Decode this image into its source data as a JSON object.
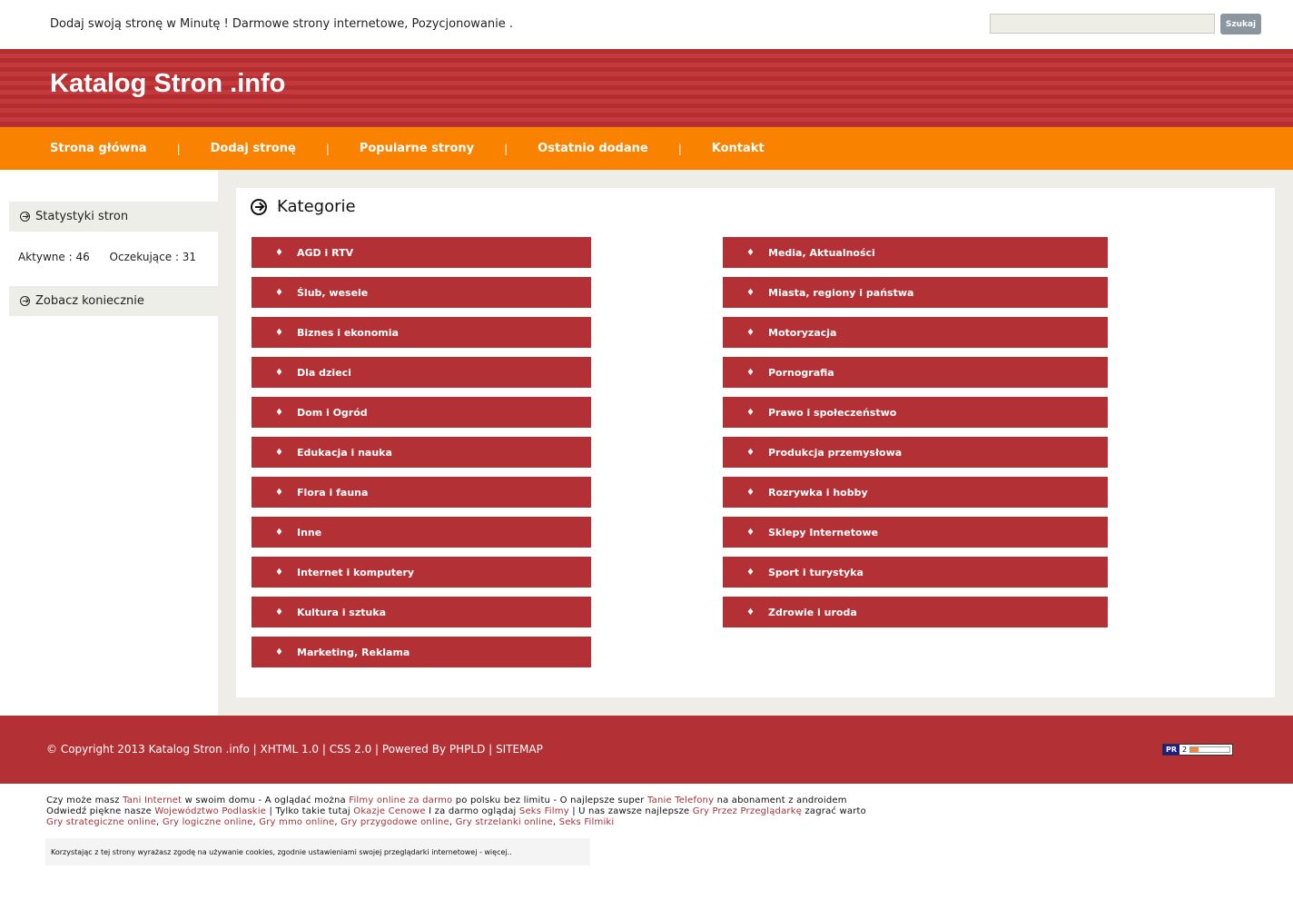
{
  "topbar": {
    "tagline": "Dodaj swoją stronę w Minutę ! Darmowe strony internetowe, Pozycjonowanie .",
    "search_button": "Szukaj"
  },
  "header": {
    "site_title": "Katalog Stron .info"
  },
  "nav": {
    "items": [
      "Strona główna",
      "Dodaj stronę",
      "Popularne strony",
      "Ostatnio dodane",
      "Kontakt"
    ],
    "separator": "|"
  },
  "sidebar": {
    "stats_title": "Statystyki stron",
    "active_label": "Aktywne : 46",
    "waiting_label": "Oczekujące : 31",
    "see_title": "Zobacz koniecznie"
  },
  "main": {
    "title": "Kategorie",
    "bullet": "♦",
    "categories_left": [
      "AGD i RTV",
      "Ślub, wesele",
      "Biznes i ekonomia",
      "Dla dzieci",
      "Dom i Ogród",
      "Edukacja i nauka",
      "Flora i fauna",
      "Inne",
      "Internet i komputery",
      "Kultura i sztuka",
      "Marketing, Reklama"
    ],
    "categories_right": [
      "Media, Aktualności",
      "Miasta, regiony i państwa",
      "Motoryzacja",
      "Pornografia",
      "Prawo i społeczeństwo",
      "Produkcja przemysłowa",
      "Rozrywka i hobby",
      "Sklepy Internetowe",
      "Sport i turystyka",
      "Zdrowie i uroda"
    ]
  },
  "footer": {
    "copyright": "© Copyright 2013 Katalog Stron .info | XHTML 1.0 | CSS 2.0 | Powered By PHPLD | SITEMAP",
    "pr_label": "PR",
    "pr_value": "2",
    "pr_fraction": 0.2
  },
  "links": {
    "line1": [
      {
        "t": "Czy może masz "
      },
      {
        "t": "Tani Internet",
        "l": true
      },
      {
        "t": " w swoim domu - A oglądać można "
      },
      {
        "t": "Filmy online za darmo",
        "l": true
      },
      {
        "t": " po polsku bez limitu - O najlepsze super "
      },
      {
        "t": "Tanie Telefony",
        "l": true
      },
      {
        "t": " na abonament z androidem"
      }
    ],
    "line2": [
      {
        "t": "Odwiedź piękne nasze "
      },
      {
        "t": "Województwo Podlaskie",
        "l": true
      },
      {
        "t": " | Tylko takie tutaj "
      },
      {
        "t": "Okazje Cenowe",
        "l": true
      },
      {
        "t": " I za darmo oglądaj "
      },
      {
        "t": "Seks Filmy",
        "l": true
      },
      {
        "t": " | U nas zawsze najlepsze "
      },
      {
        "t": "Gry Przez Przeglądarkę",
        "l": true
      },
      {
        "t": " zagrać warto"
      }
    ],
    "line3": [
      {
        "t": "Gry strategiczne online",
        "l": true
      },
      {
        "t": ", "
      },
      {
        "t": "Gry logiczne online",
        "l": true
      },
      {
        "t": ", "
      },
      {
        "t": "Gry mmo online",
        "l": true
      },
      {
        "t": ", "
      },
      {
        "t": "Gry przygodowe online",
        "l": true
      },
      {
        "t": ", "
      },
      {
        "t": "Gry strzelanki online",
        "l": true
      },
      {
        "t": ", "
      },
      {
        "t": "Seks Filmiki",
        "l": true
      }
    ]
  },
  "cookie": {
    "text": "Korzystając z tej strony wyrażasz zgodę na używanie cookies, zgodnie ustawieniami swojej przeglądarki internetowej - więcej.."
  }
}
